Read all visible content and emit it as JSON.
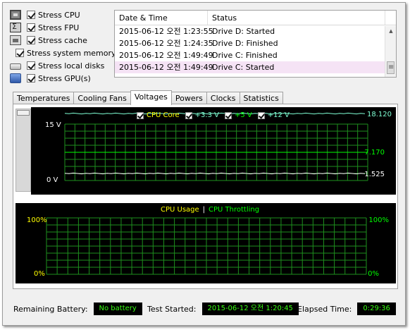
{
  "stress": [
    {
      "label": "Stress CPU",
      "icon": "cpu-icon",
      "checked": true
    },
    {
      "label": "Stress FPU",
      "icon": "fpu-icon",
      "checked": true
    },
    {
      "label": "Stress cache",
      "icon": "cache-icon",
      "checked": true
    },
    {
      "label": "Stress system memory",
      "icon": "memory-icon",
      "checked": true
    },
    {
      "label": "Stress local disks",
      "icon": "disk-icon",
      "checked": true
    },
    {
      "label": "Stress GPU(s)",
      "icon": "gpu-icon",
      "checked": true
    }
  ],
  "log": {
    "headers": {
      "date": "Date & Time",
      "status": "Status"
    },
    "rows": [
      {
        "date": "2015-06-12 오전 1:23:55",
        "status": "Drive D: Started"
      },
      {
        "date": "2015-06-12 오전 1:24:35",
        "status": "Drive D: Finished"
      },
      {
        "date": "2015-06-12 오전 1:49:49",
        "status": "Drive C: Finished"
      },
      {
        "date": "2015-06-12 오전 1:49:49",
        "status": "Drive C: Started"
      }
    ]
  },
  "tabs": [
    "Temperatures",
    "Cooling Fans",
    "Voltages",
    "Powers",
    "Clocks",
    "Statistics"
  ],
  "active_tab": "Voltages",
  "voltage_chart": {
    "legend": [
      {
        "label": "CPU Core",
        "color": "#ffff00"
      },
      {
        "label": "+3.3 V",
        "color": "#7fffd4"
      },
      {
        "label": "+5 V",
        "color": "#00ff00"
      },
      {
        "label": "+12 V",
        "color": "#7fffd4"
      }
    ],
    "y_top": "15 V",
    "y_bottom": "0 V",
    "right_labels": [
      {
        "text": "18.120",
        "color": "#7fffd4"
      },
      {
        "text": "7.170",
        "color": "#00ff00"
      },
      {
        "text": "1.525",
        "color": "#ffffff"
      }
    ]
  },
  "usage_chart": {
    "title_usage": "CPU Usage",
    "separator": "|",
    "title_throttle": "CPU Throttling",
    "usage_color": "#ffff00",
    "throttle_color": "#00ff00",
    "y_top": "100%",
    "y_bottom": "0%",
    "right_top": "100%",
    "right_bottom": "0%"
  },
  "status": {
    "battery_label": "Remaining Battery:",
    "battery_value": "No battery",
    "started_label": "Test Started:",
    "started_value": "2015-06-12 오전 1:20:45",
    "elapsed_label": "Elapsed Time:",
    "elapsed_value": "0:29:36"
  }
}
